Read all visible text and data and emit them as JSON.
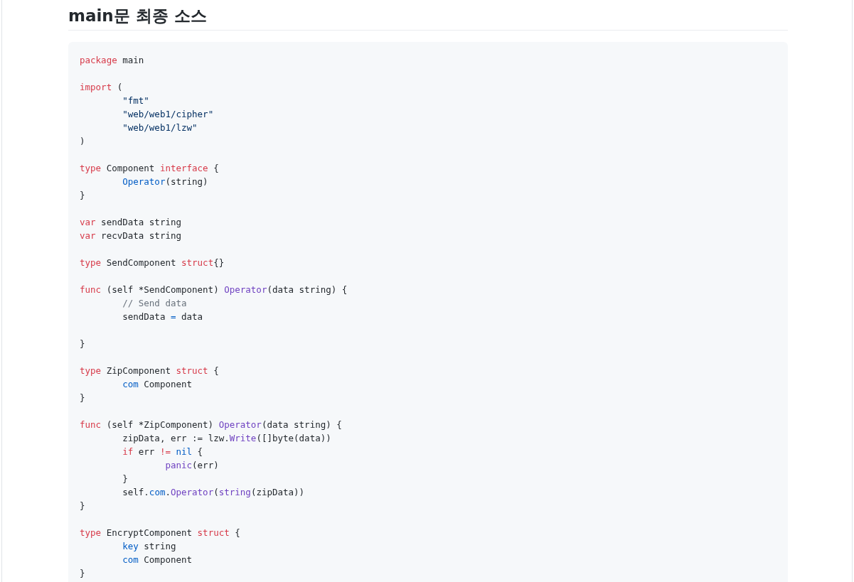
{
  "heading": "main문 최종 소스",
  "code_lines": [
    {
      "kind": "code",
      "tokens": [
        {
          "kind": "keyword",
          "text": "package"
        },
        {
          "kind": "plain",
          "text": " main"
        }
      ]
    },
    {
      "kind": "blank"
    },
    {
      "kind": "code",
      "tokens": [
        {
          "kind": "keyword",
          "text": "import"
        },
        {
          "kind": "plain",
          "text": " ("
        }
      ]
    },
    {
      "kind": "code",
      "tokens": [
        {
          "kind": "string",
          "text": "\t\"fmt\""
        }
      ]
    },
    {
      "kind": "code",
      "tokens": [
        {
          "kind": "string",
          "text": "\t\"web/web1/cipher\""
        }
      ]
    },
    {
      "kind": "code",
      "tokens": [
        {
          "kind": "string",
          "text": "\t\"web/web1/lzw\""
        }
      ]
    },
    {
      "kind": "code",
      "tokens": [
        {
          "kind": "plain",
          "text": ")"
        }
      ]
    },
    {
      "kind": "blank"
    },
    {
      "kind": "code",
      "tokens": [
        {
          "kind": "keyword",
          "text": "type"
        },
        {
          "kind": "plain",
          "text": " Component "
        },
        {
          "kind": "keyword",
          "text": "interface"
        },
        {
          "kind": "plain",
          "text": " {"
        }
      ]
    },
    {
      "kind": "code",
      "tokens": [
        {
          "kind": "constant",
          "text": "\tOperator"
        },
        {
          "kind": "plain",
          "text": "(string)"
        }
      ]
    },
    {
      "kind": "code",
      "tokens": [
        {
          "kind": "plain",
          "text": "}"
        }
      ]
    },
    {
      "kind": "blank"
    },
    {
      "kind": "code",
      "tokens": [
        {
          "kind": "keyword",
          "text": "var"
        },
        {
          "kind": "plain",
          "text": " sendData string"
        }
      ]
    },
    {
      "kind": "code",
      "tokens": [
        {
          "kind": "keyword",
          "text": "var"
        },
        {
          "kind": "plain",
          "text": " recvData string"
        }
      ]
    },
    {
      "kind": "blank"
    },
    {
      "kind": "code",
      "tokens": [
        {
          "kind": "keyword",
          "text": "type"
        },
        {
          "kind": "plain",
          "text": " SendComponent "
        },
        {
          "kind": "keyword",
          "text": "struct"
        },
        {
          "kind": "plain",
          "text": "{}"
        }
      ]
    },
    {
      "kind": "blank"
    },
    {
      "kind": "code",
      "tokens": [
        {
          "kind": "keyword",
          "text": "func"
        },
        {
          "kind": "plain",
          "text": " (self *SendComponent) "
        },
        {
          "kind": "function",
          "text": "Operator"
        },
        {
          "kind": "plain",
          "text": "(data string) {"
        }
      ]
    },
    {
      "kind": "code",
      "tokens": [
        {
          "kind": "comment",
          "text": "\t// Send data"
        }
      ]
    },
    {
      "kind": "code",
      "tokens": [
        {
          "kind": "plain",
          "text": "\tsendData "
        },
        {
          "kind": "constant",
          "text": "="
        },
        {
          "kind": "plain",
          "text": " data"
        }
      ]
    },
    {
      "kind": "blank"
    },
    {
      "kind": "code",
      "tokens": [
        {
          "kind": "plain",
          "text": "}"
        }
      ]
    },
    {
      "kind": "blank"
    },
    {
      "kind": "code",
      "tokens": [
        {
          "kind": "keyword",
          "text": "type"
        },
        {
          "kind": "plain",
          "text": " ZipComponent "
        },
        {
          "kind": "keyword",
          "text": "struct"
        },
        {
          "kind": "plain",
          "text": " {"
        }
      ]
    },
    {
      "kind": "code",
      "tokens": [
        {
          "kind": "constant",
          "text": "\tcom"
        },
        {
          "kind": "plain",
          "text": " Component"
        }
      ]
    },
    {
      "kind": "code",
      "tokens": [
        {
          "kind": "plain",
          "text": "}"
        }
      ]
    },
    {
      "kind": "blank"
    },
    {
      "kind": "code",
      "tokens": [
        {
          "kind": "keyword",
          "text": "func"
        },
        {
          "kind": "plain",
          "text": " (self *ZipComponent) "
        },
        {
          "kind": "function",
          "text": "Operator"
        },
        {
          "kind": "plain",
          "text": "(data string) {"
        }
      ]
    },
    {
      "kind": "code",
      "tokens": [
        {
          "kind": "plain",
          "text": "\tzipData, err := lzw."
        },
        {
          "kind": "function",
          "text": "Write"
        },
        {
          "kind": "plain",
          "text": "([]byte(data))"
        }
      ]
    },
    {
      "kind": "code",
      "tokens": [
        {
          "kind": "keyword",
          "text": "\tif"
        },
        {
          "kind": "plain",
          "text": " err "
        },
        {
          "kind": "keyword",
          "text": "!="
        },
        {
          "kind": "constant",
          "text": " nil"
        },
        {
          "kind": "plain",
          "text": " {"
        }
      ]
    },
    {
      "kind": "code",
      "tokens": [
        {
          "kind": "function",
          "text": "\t\tpanic"
        },
        {
          "kind": "plain",
          "text": "(err)"
        }
      ]
    },
    {
      "kind": "code",
      "tokens": [
        {
          "kind": "plain",
          "text": "\t}"
        }
      ]
    },
    {
      "kind": "code",
      "tokens": [
        {
          "kind": "plain",
          "text": "\tself."
        },
        {
          "kind": "constant",
          "text": "com"
        },
        {
          "kind": "plain",
          "text": "."
        },
        {
          "kind": "function",
          "text": "Operator"
        },
        {
          "kind": "plain",
          "text": "("
        },
        {
          "kind": "function",
          "text": "string"
        },
        {
          "kind": "plain",
          "text": "(zipData))"
        }
      ]
    },
    {
      "kind": "code",
      "tokens": [
        {
          "kind": "plain",
          "text": "}"
        }
      ]
    },
    {
      "kind": "blank"
    },
    {
      "kind": "code",
      "tokens": [
        {
          "kind": "keyword",
          "text": "type"
        },
        {
          "kind": "plain",
          "text": " EncryptComponent "
        },
        {
          "kind": "keyword",
          "text": "struct"
        },
        {
          "kind": "plain",
          "text": " {"
        }
      ]
    },
    {
      "kind": "code",
      "tokens": [
        {
          "kind": "constant",
          "text": "\tkey"
        },
        {
          "kind": "plain",
          "text": " string"
        }
      ]
    },
    {
      "kind": "code",
      "tokens": [
        {
          "kind": "constant",
          "text": "\tcom"
        },
        {
          "kind": "plain",
          "text": " Component"
        }
      ]
    },
    {
      "kind": "code",
      "tokens": [
        {
          "kind": "plain",
          "text": "}"
        }
      ]
    }
  ]
}
